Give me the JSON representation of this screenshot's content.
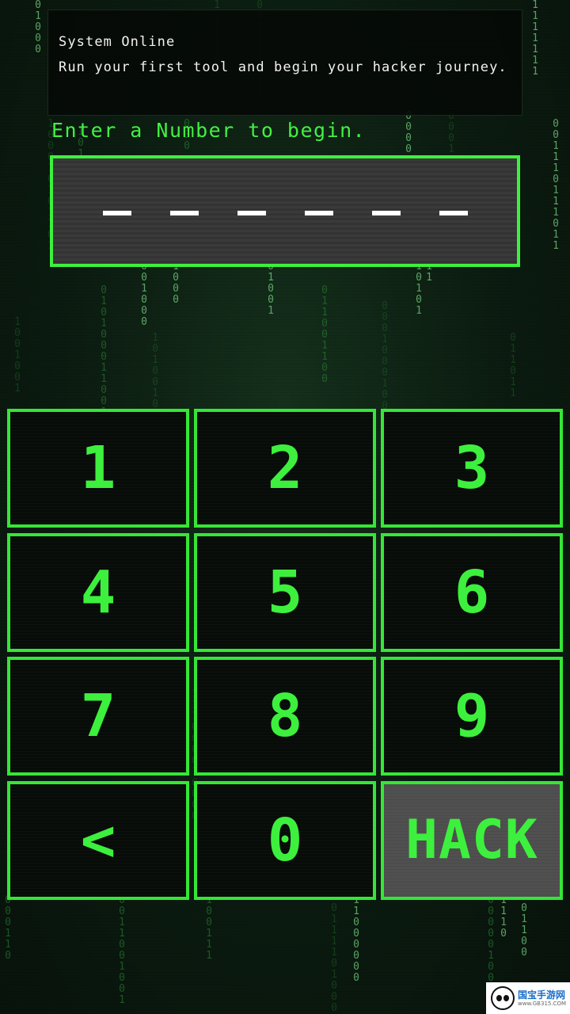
{
  "message": {
    "line1": "System Online",
    "line2": "Run your first tool and begin your hacker journey."
  },
  "prompt": "Enter a Number to begin.",
  "code_display": {
    "slots": [
      "—",
      "—",
      "—",
      "—",
      "—",
      "—"
    ]
  },
  "keypad": {
    "keys": [
      "1",
      "2",
      "3",
      "4",
      "5",
      "6",
      "7",
      "8",
      "9",
      "<",
      "0",
      "HACK"
    ]
  },
  "watermark": {
    "title": "国宝手游网",
    "url": "www.GB315.COM"
  },
  "colors": {
    "accent_green": "#3df03d",
    "background": "#0c1a10",
    "hack_button": "#505050"
  }
}
